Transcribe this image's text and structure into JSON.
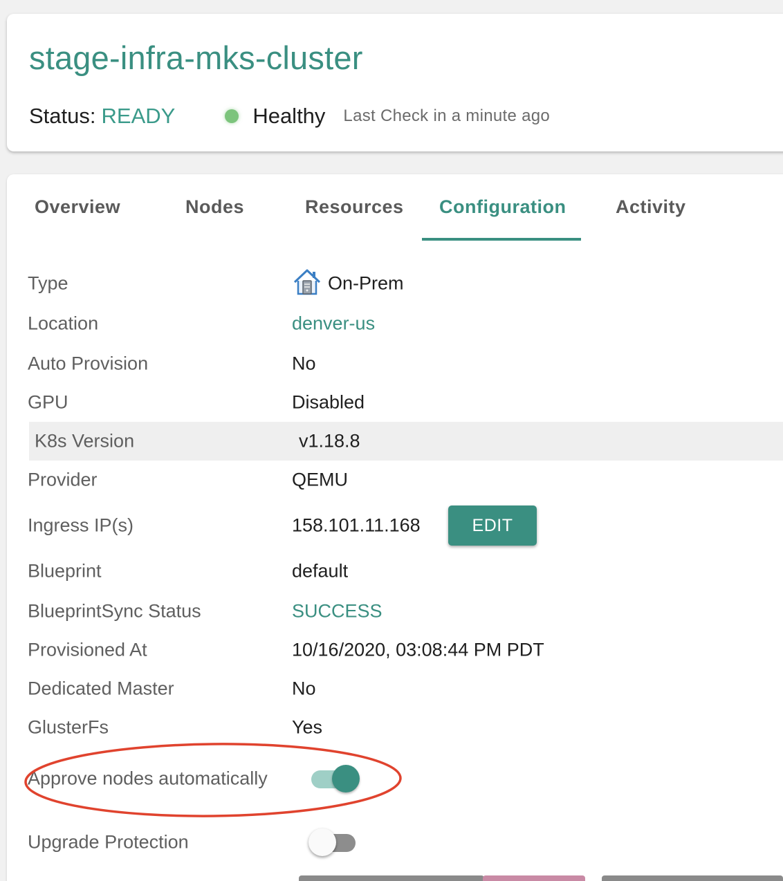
{
  "header": {
    "cluster_name": "stage-infra-mks-cluster",
    "status_label": "Status:",
    "status_value": "READY",
    "health": "Healthy",
    "last_check": "Last Check in a minute ago",
    "health_color": "#7cc47c"
  },
  "tabs": [
    {
      "label": "Overview",
      "active": false
    },
    {
      "label": "Nodes",
      "active": false
    },
    {
      "label": "Resources",
      "active": false
    },
    {
      "label": "Configuration",
      "active": true
    },
    {
      "label": "Activity",
      "active": false
    }
  ],
  "config": {
    "type": {
      "label": "Type",
      "value": "On-Prem",
      "icon": "house-server-icon"
    },
    "location": {
      "label": "Location",
      "value": "denver-us"
    },
    "auto_provision": {
      "label": "Auto Provision",
      "value": "No"
    },
    "gpu": {
      "label": "GPU",
      "value": "Disabled"
    },
    "k8s_version": {
      "label": "K8s Version",
      "value": "v1.18.8"
    },
    "provider": {
      "label": "Provider",
      "value": "QEMU"
    },
    "ingress": {
      "label": "Ingress IP(s)",
      "value": "158.101.11.168",
      "edit_label": "EDIT"
    },
    "blueprint": {
      "label": "Blueprint",
      "value": "default"
    },
    "blueprint_sync": {
      "label": "BlueprintSync Status",
      "value": "SUCCESS"
    },
    "provisioned_at": {
      "label": "Provisioned At",
      "value": "10/16/2020, 03:08:44 PM PDT"
    },
    "dedicated_master": {
      "label": "Dedicated Master",
      "value": "No"
    },
    "glusterfs": {
      "label": "GlusterFs",
      "value": "Yes"
    },
    "approve_nodes": {
      "label": "Approve nodes automatically",
      "enabled": true
    },
    "upgrade_protection": {
      "label": "Upgrade Protection",
      "enabled": false
    }
  },
  "colors": {
    "accent": "#3a8f81",
    "highlight_ellipse": "#e0432e"
  }
}
